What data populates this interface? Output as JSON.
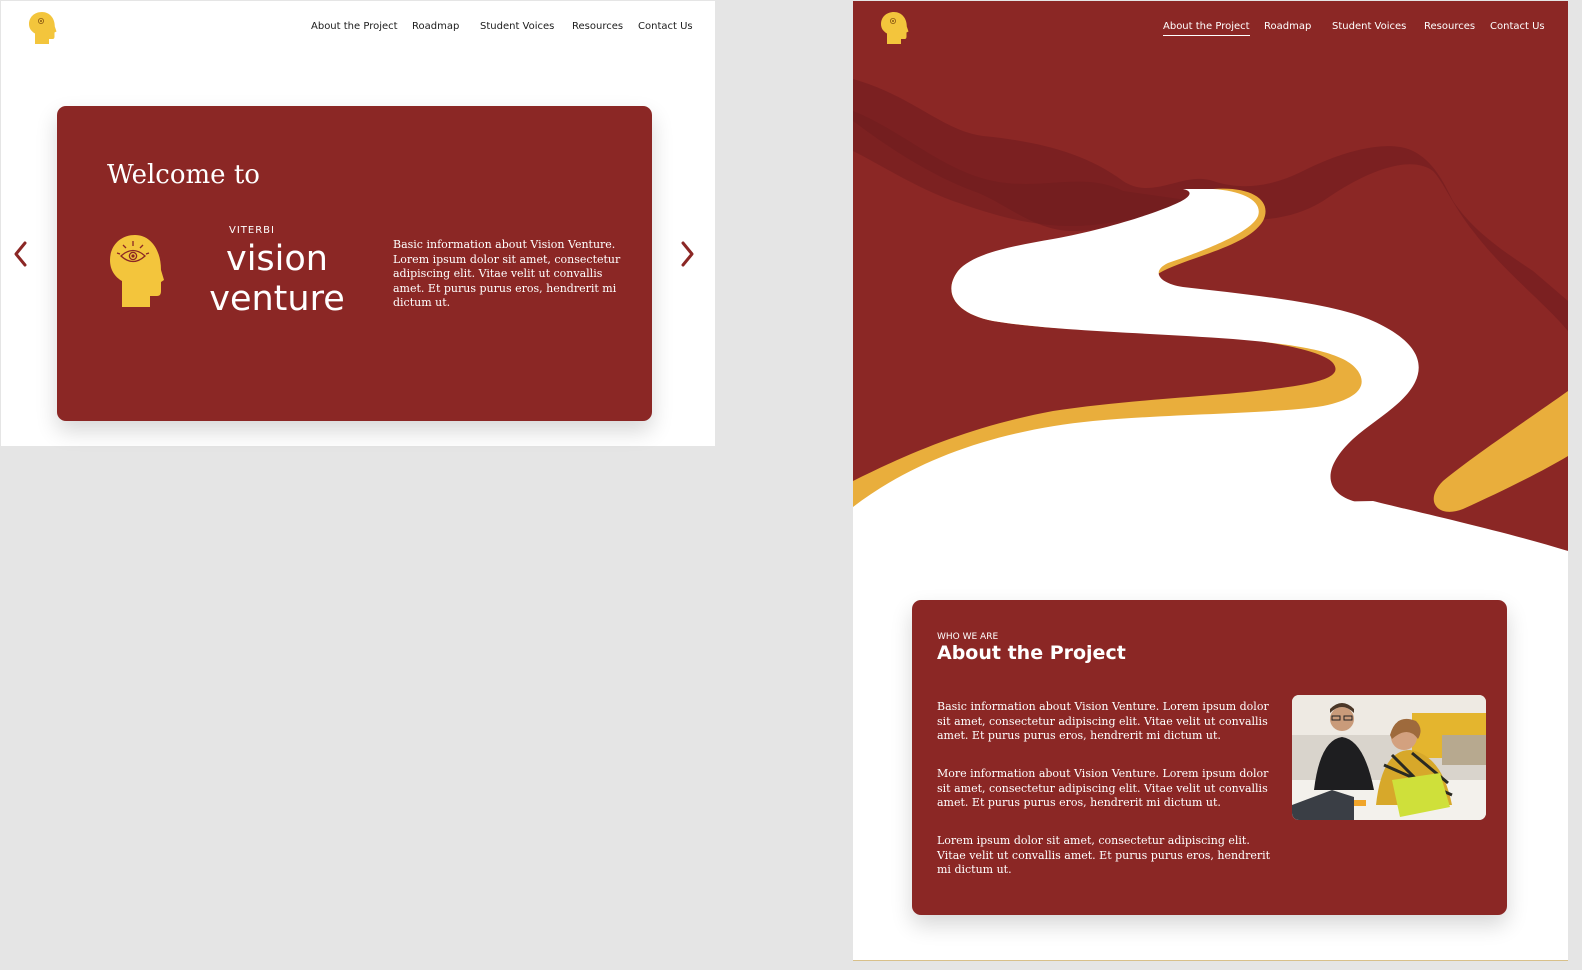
{
  "nav": {
    "items": [
      "About the Project",
      "Roadmap",
      "Student Voices",
      "Resources",
      "Contact Us"
    ],
    "active": "About the Project"
  },
  "icons": {
    "logo": "head-with-eye-icon",
    "prev": "chevron-left-icon",
    "next": "chevron-right-icon"
  },
  "hero": {
    "welcome": "Welcome to",
    "brand_sub": "VITERBI",
    "brand_line1": "vision",
    "brand_line2": "venture",
    "description": "Basic information about Vision Venture. Lorem ipsum dolor sit amet, consectetur adipiscing elit. Vitae velit ut convallis amet. Et purus purus eros, hendrerit mi dictum ut."
  },
  "about": {
    "eyebrow": "WHO WE ARE",
    "title": "About the Project",
    "paragraphs": [
      "Basic information about Vision Venture. Lorem ipsum dolor sit amet, consectetur adipiscing elit. Vitae velit ut convallis amet. Et purus purus eros, hendrerit mi dictum ut.",
      "More information about Vision Venture. Lorem ipsum dolor sit amet, consectetur adipiscing elit. Vitae velit ut convallis amet. Et purus purus eros, hendrerit mi dictum ut.",
      "Lorem ipsum dolor sit amet, consectetur adipiscing elit. Vitae velit ut convallis amet. Et purus purus eros, hendrerit mi dictum ut."
    ]
  },
  "colors": {
    "brand_red": "#8b2725",
    "brand_yellow": "#f3c53c",
    "road_gold": "#e9ae3c",
    "page_bg": "#e5e5e5"
  }
}
